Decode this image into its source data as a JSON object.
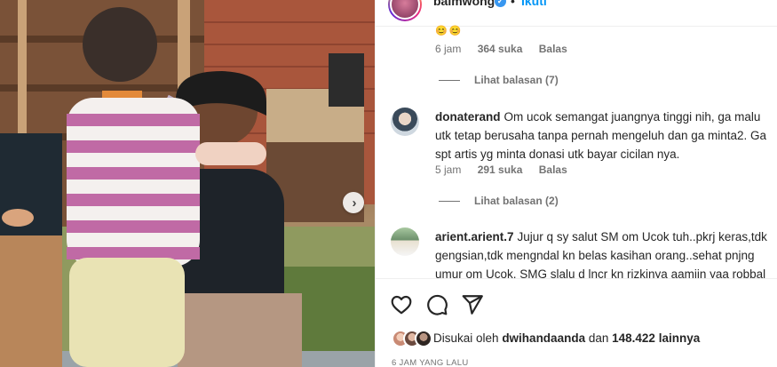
{
  "post": {
    "image_description_icon": "photo",
    "next_icon": "chevron-right-icon"
  },
  "header": {
    "username": "baimwong",
    "separator": "•",
    "follow_label": "Ikuti",
    "verified_icon": "verified-badge-icon"
  },
  "comments": [
    {
      "emoji": "😊😊",
      "time": "6 jam",
      "likes": "364 suka",
      "reply_label": "Balas",
      "view_replies": "Lihat balasan (7)"
    },
    {
      "username": "donaterand",
      "text": "Om ucok semangat juangnya tinggi nih, ga malu utk tetap berusaha tanpa pernah mengeluh dan ga minta2. Ga spt artis yg minta donasi utk bayar cicilan nya.",
      "time": "5 jam",
      "likes": "291 suka",
      "reply_label": "Balas",
      "view_replies": "Lihat balasan (2)"
    },
    {
      "username": "arient.arient.7",
      "text": "Jujur q sy salut SM om Ucok tuh..pkrj keras,tdk gengsian,tdk mengndal kn belas kasihan orang..sehat pnjng umur om Ucok. SMG slalu d lncr kn rizkinya aamiin yaa robbal"
    }
  ],
  "actions": {
    "like_icon": "heart-icon",
    "comment_icon": "comment-icon",
    "share_icon": "share-icon"
  },
  "likes_summary": {
    "prefix": "Disukai oleh",
    "user": "dwihandaanda",
    "connector": "dan",
    "others": "148.422 lainnya"
  },
  "timestamp": "6 jam yang lalu",
  "colors": {
    "link_blue": "#0095f6",
    "text_primary": "#262626",
    "text_secondary": "#737373",
    "divider": "#efefef"
  }
}
